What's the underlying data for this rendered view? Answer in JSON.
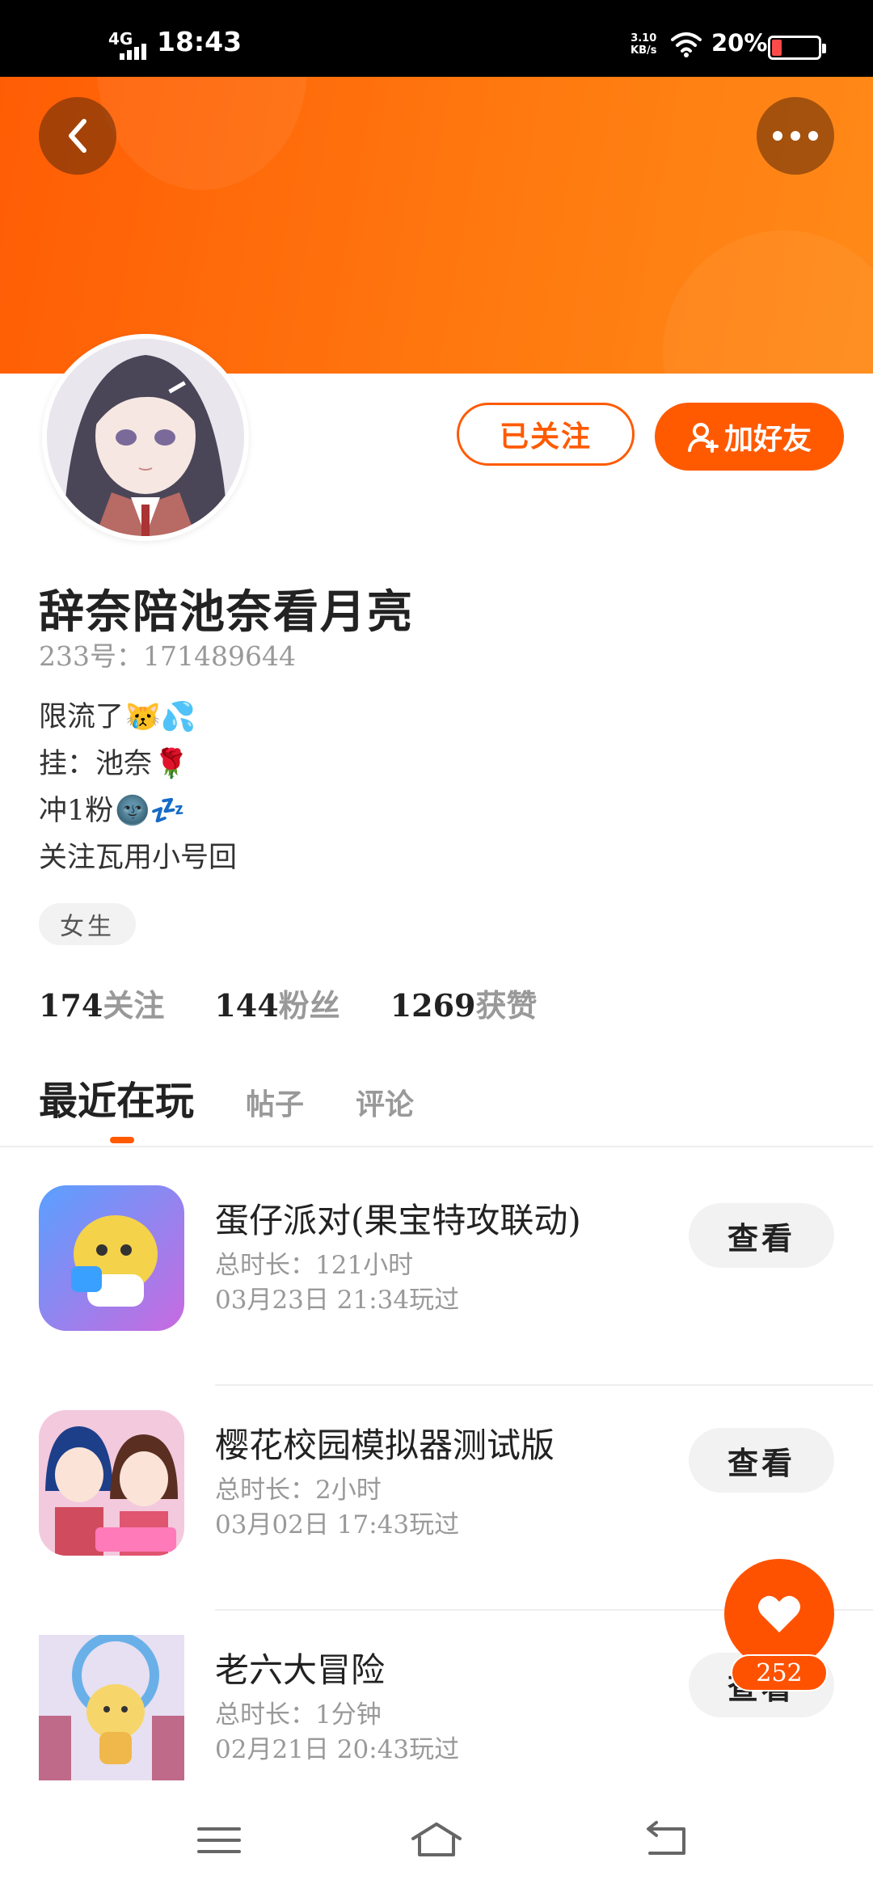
{
  "status_bar": {
    "network": "4G",
    "time": "18:43",
    "speed_value": "3.10",
    "speed_unit": "KB/s",
    "battery": "20%"
  },
  "header": {
    "back_icon": "back-chevron-icon",
    "more_icon": "more-dots-icon",
    "banner_color": "#ff6a0a"
  },
  "profile": {
    "followed_label": "已关注",
    "add_friend_label": "加好友",
    "nickname": "辞奈陪池奈看月亮",
    "uid": "233号：171489644",
    "bio": [
      {
        "text": "限流了",
        "emoji": "😿💦"
      },
      {
        "text": "挂：池奈",
        "emoji": "🌹"
      },
      {
        "text": "冲1粉",
        "emoji": "🌚💤"
      },
      {
        "text": "关注瓦用小号回",
        "emoji": ""
      }
    ],
    "gender": "女生"
  },
  "stats": [
    {
      "num": "174",
      "label": "关注"
    },
    {
      "num": "144",
      "label": "粉丝"
    },
    {
      "num": "1269",
      "label": "获赞"
    }
  ],
  "tabs": [
    {
      "label": "最近在玩",
      "active": true
    },
    {
      "label": "帖子",
      "active": false
    },
    {
      "label": "评论",
      "active": false
    }
  ],
  "games": [
    {
      "title": "蛋仔派对(果宝特攻联动)",
      "time": "总时长：121小时",
      "played": "03月23日 21:34玩过",
      "view": "查看"
    },
    {
      "title": "樱花校园模拟器测试版",
      "time": "总时长：2小时",
      "played": "03月02日 17:43玩过",
      "view": "查看"
    },
    {
      "title": "老六大冒险",
      "time": "总时长：1分钟",
      "played": "02月21日 20:43玩过",
      "view": "查看"
    }
  ],
  "like": {
    "count": "252"
  },
  "colors": {
    "accent": "#ff5a00",
    "muted": "#999999"
  }
}
